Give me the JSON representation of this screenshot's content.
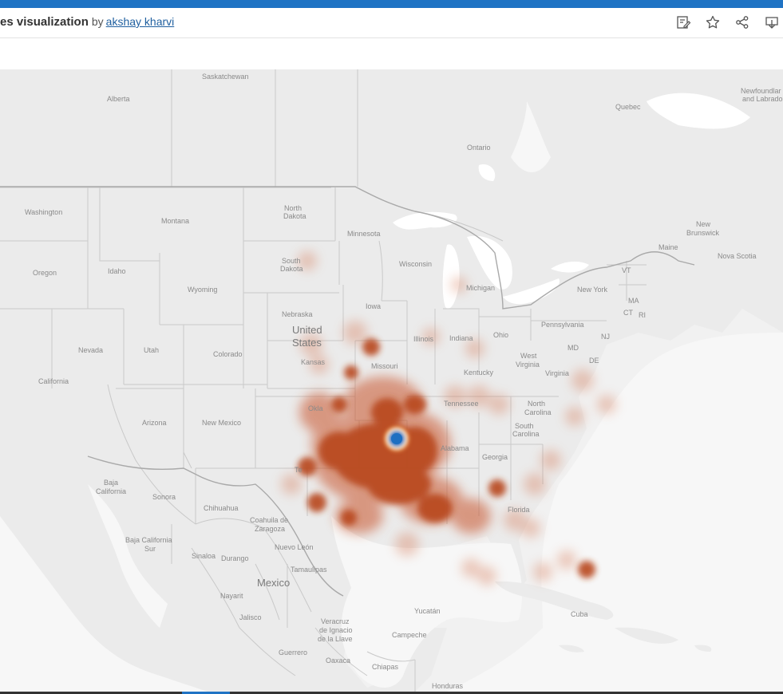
{
  "header": {
    "title": "es visualization",
    "by": "by",
    "author": "akshay kharvi",
    "icons": [
      "edit-icon",
      "favorite-star-icon",
      "share-icon",
      "download-icon"
    ]
  },
  "colors": {
    "topbar": "#1f73c4",
    "heat_outer": "#c8522a",
    "heat_core": "#b8461d",
    "hotspot": "#1e6fc1",
    "water": "#ffffff",
    "land": "#ebebeb"
  },
  "map": {
    "labels": {
      "saskatchewan": "Saskatchewan",
      "alberta": "Alberta",
      "quebec": "Quebec",
      "newfoundland": "Newfoundlar",
      "labrador": "and Labrado",
      "ontario": "Ontario",
      "washington": "Washington",
      "montana": "Montana",
      "north_dakota_1": "North",
      "north_dakota_2": "Dakota",
      "minnesota": "Minnesota",
      "new_brunswick_1": "New",
      "new_brunswick_2": "Brunswick",
      "maine": "Maine",
      "nova_scotia": "Nova Scotia",
      "oregon": "Oregon",
      "idaho": "Idaho",
      "south_dakota_1": "South",
      "south_dakota_2": "Dakota",
      "wisconsin": "Wisconsin",
      "vt": "VT",
      "michigan": "Michigan",
      "new_york": "New York",
      "ma": "MA",
      "ct": "CT",
      "ri": "RI",
      "wyoming": "Wyoming",
      "iowa": "Iowa",
      "nebraska": "Nebraska",
      "united_states_1": "United",
      "united_states_2": "States",
      "pennsylvania": "Pennsylvania",
      "nj": "NJ",
      "nevada": "Nevada",
      "utah": "Utah",
      "colorado": "Colorado",
      "illinois": "Illinois",
      "indiana": "Indiana",
      "ohio": "Ohio",
      "md": "MD",
      "de": "DE",
      "kansas": "Kansas",
      "missouri": "Missouri",
      "west_virginia_1": "West",
      "west_virginia_2": "Virginia",
      "virginia": "Virginia",
      "kentucky": "Kentucky",
      "california": "California",
      "oklahoma": "Okla",
      "tennessee": "Tennessee",
      "north_carolina_1": "North",
      "north_carolina_2": "Carolina",
      "arizona": "Arizona",
      "new_mexico": "New Mexico",
      "south_carolina_1": "South",
      "south_carolina_2": "Carolina",
      "alabama": "Alabama",
      "georgia": "Georgia",
      "texas": "Te",
      "baja_california_1": "Baja",
      "baja_california_2": "California",
      "sonora": "Sonora",
      "chihuahua": "Chihuahua",
      "florida": "Florida",
      "coahuila_1": "Coahuila de",
      "coahuila_2": "Zaragoza",
      "baja_california_sur_1": "Baja California",
      "baja_california_sur_2": "Sur",
      "nuevo_leon": "Nuevo León",
      "sinaloa": "Sinaloa",
      "durango": "Durango",
      "tamaulipas": "Tamaulipas",
      "mexico": "Mexico",
      "nayarit": "Nayarit",
      "jalisco": "Jalisco",
      "yucatan": "Yucatán",
      "cuba": "Cuba",
      "veracruz_1": "Veracruz",
      "veracruz_2": "de Ignacio",
      "veracruz_3": "de la Llave",
      "campeche": "Campeche",
      "guerrero": "Guerrero",
      "oaxaca": "Oaxaca",
      "chiapas": "Chiapas",
      "honduras": "Honduras"
    }
  }
}
